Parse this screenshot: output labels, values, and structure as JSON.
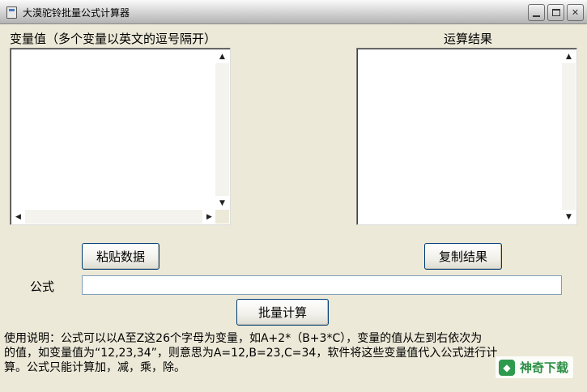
{
  "window": {
    "title": "大漠驼铃批量公式计算器",
    "icon": "app-icon"
  },
  "labels": {
    "variables": "变量值（多个变量以英文的逗号隔开）",
    "result": "运算结果",
    "formula": "公式"
  },
  "variables_list": {
    "value": ""
  },
  "result_list": {
    "value": ""
  },
  "buttons": {
    "paste": "粘贴数据",
    "copy": "复制结果",
    "calculate": "批量计算"
  },
  "formula_input": {
    "value": "",
    "placeholder": ""
  },
  "scroll_arrows": {
    "up": "▲",
    "down": "▼",
    "left": "◀",
    "right": "▶"
  },
  "instructions": {
    "line1": "使用说明：公式可以以A至Z这26个字母为变量，如A+2*（B+3*C），变量的值从左到右依次为",
    "line2": "的值，如变量值为“12,23,34”，则意思为A=12,B=23,C=34，软件将这些变量值代入公式进行计",
    "line3": "算。公式只能计算加，减，乘，除。"
  },
  "watermark": {
    "text": "神奇下载",
    "logo_glyph": "◆"
  }
}
